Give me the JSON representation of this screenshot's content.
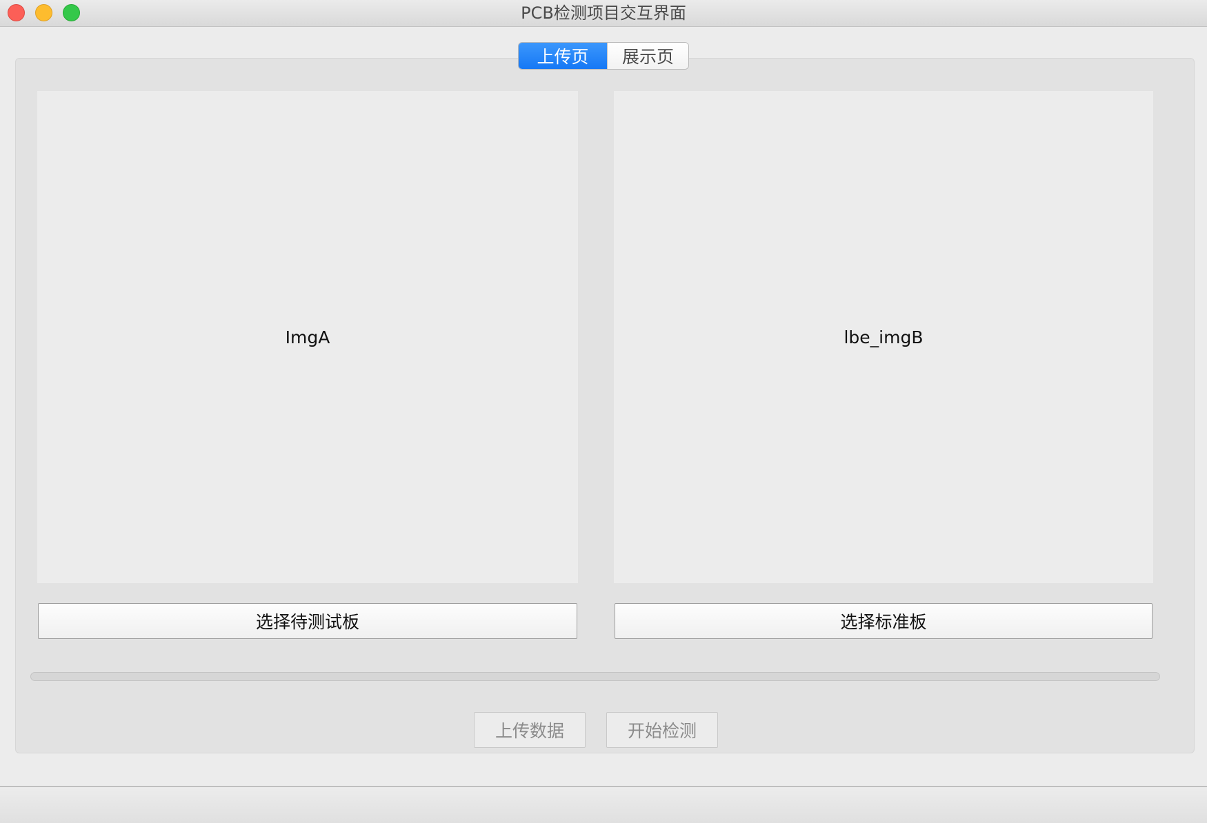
{
  "window": {
    "title": "PCB检测项目交互界面"
  },
  "tabs": [
    {
      "label": "上传页",
      "active": true
    },
    {
      "label": "展示页",
      "active": false
    }
  ],
  "panels": {
    "left": {
      "image_label": "ImgA",
      "button_label": "选择待测试板"
    },
    "right": {
      "image_label": "lbe_imgB",
      "button_label": "选择标准板"
    }
  },
  "progress": {
    "value": 0
  },
  "actions": {
    "upload_label": "上传数据",
    "start_label": "开始检测",
    "enabled": false
  },
  "colors": {
    "accent": "#1678f5",
    "close": "#fc5f57",
    "minimize": "#fdbc2e",
    "maximize": "#34c84a"
  },
  "icons": {
    "close": "close-icon",
    "minimize": "minimize-icon",
    "maximize": "maximize-icon"
  }
}
